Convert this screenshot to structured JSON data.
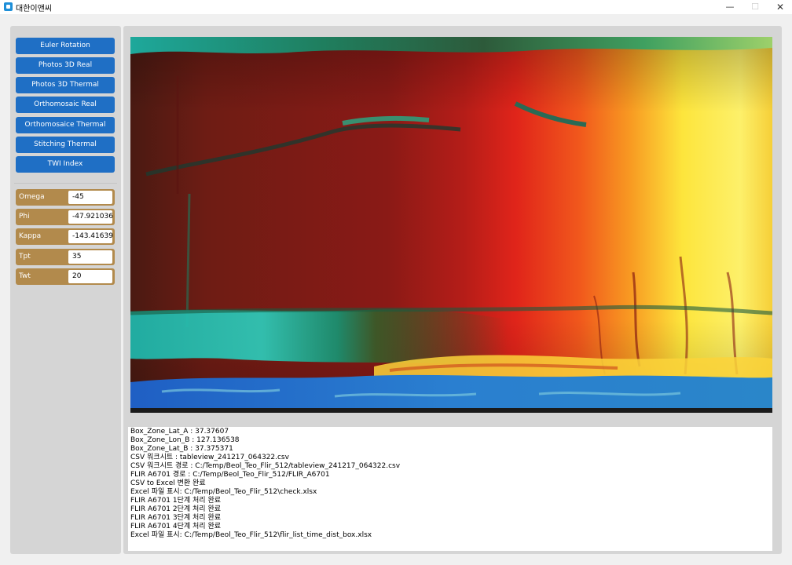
{
  "window": {
    "title": "대한이앤씨",
    "controls": {
      "minimize": "—",
      "maximize": "☐",
      "close": "✕"
    }
  },
  "sidebar": {
    "buttons": [
      {
        "label": "Euler Rotation"
      },
      {
        "label": "Photos 3D Real"
      },
      {
        "label": "Photos 3D Thermal"
      },
      {
        "label": "Orthomosaic Real"
      },
      {
        "label": "Orthomosaice Thermal"
      },
      {
        "label": "Stitching Thermal"
      },
      {
        "label": "TWI Index"
      }
    ],
    "params": [
      {
        "label": "Omega",
        "value": "-45"
      },
      {
        "label": "Phi",
        "value": "-47.921036"
      },
      {
        "label": "Kappa",
        "value": "-143.41639"
      },
      {
        "label": "Tpt",
        "value": "35"
      },
      {
        "label": "Twt",
        "value": "20"
      }
    ]
  },
  "viewer": {
    "image": "thermal-image"
  },
  "log": {
    "lines": [
      "Box_Zone_Lat_A : 37.37607",
      "Box_Zone_Lon_B : 127.136538",
      "Box_Zone_Lat_B : 37.375371",
      "CSV 워크시트 : tableview_241217_064322.csv",
      "CSV 워크시트 경로 : C:/Temp/Beol_Teo_Flir_512/tableview_241217_064322.csv",
      "FLIR A6701 경로 : C:/Temp/Beol_Teo_Flir_512/FLIR_A6701",
      "CSV to Excel 변환 완료",
      "Excel 파일 표시: C:/Temp/Beol_Teo_Flir_512\\check.xlsx",
      "FLIR A6701 1단계 처리 완료",
      "FLIR A6701 2단계 처리 완료",
      "FLIR A6701 3단계 처리 완료",
      "FLIR A6701 4단계 처리 완료",
      "Excel 파일 표시: C:/Temp/Beol_Teo_Flir_512\\flir_list_time_dist_box.xlsx"
    ]
  },
  "colors": {
    "button_blue": "#1f6fc5",
    "param_gold": "#b28a4c",
    "panel_gray": "#d5d5d5"
  }
}
